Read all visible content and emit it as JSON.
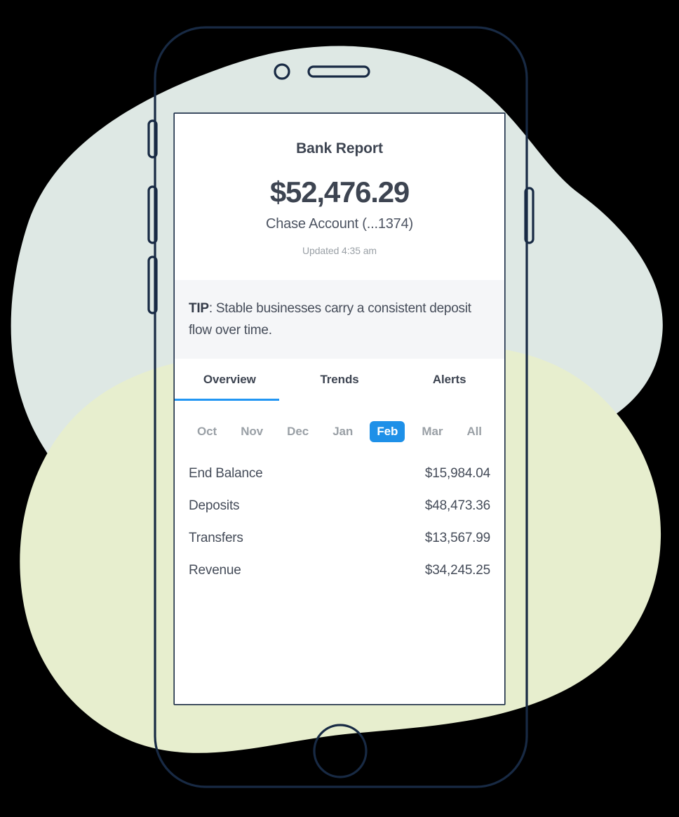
{
  "colors": {
    "blob_mint": "#dee8e4",
    "blob_lime": "#e7eece",
    "frame_outline": "#182a44",
    "accent_blue": "#1e90e8",
    "tab_underline": "#2196f3",
    "text_dark": "#3d4451",
    "text_muted": "#9aa0a6",
    "tip_background": "#f5f6f8",
    "screen_background": "#ffffff",
    "page_background": "#000000"
  },
  "device": {
    "type": "smartphone-mockup",
    "buttons": [
      "mute-switch",
      "volume-up",
      "volume-down",
      "power"
    ],
    "features": [
      "front-camera",
      "earpiece-speaker",
      "home-button"
    ]
  },
  "screen": {
    "header": {
      "title": "Bank Report",
      "balance": "$52,476.29",
      "account": "Chase Account (...1374)",
      "updated": "Updated 4:35 am"
    },
    "tip": {
      "label": "TIP",
      "separator": ": ",
      "text": "Stable businesses carry a consistent deposit flow over time."
    },
    "tabs": [
      {
        "label": "Overview",
        "active": true
      },
      {
        "label": "Trends",
        "active": false
      },
      {
        "label": "Alerts",
        "active": false
      }
    ],
    "months": [
      {
        "label": "Oct",
        "active": false
      },
      {
        "label": "Nov",
        "active": false
      },
      {
        "label": "Dec",
        "active": false
      },
      {
        "label": "Jan",
        "active": false
      },
      {
        "label": "Feb",
        "active": true
      },
      {
        "label": "Mar",
        "active": false
      },
      {
        "label": "All",
        "active": false
      }
    ],
    "rows": [
      {
        "label": "End Balance",
        "value": "$15,984.04"
      },
      {
        "label": "Deposits",
        "value": "$48,473.36"
      },
      {
        "label": "Transfers",
        "value": "$13,567.99"
      },
      {
        "label": "Revenue",
        "value": "$34,245.25"
      }
    ]
  }
}
